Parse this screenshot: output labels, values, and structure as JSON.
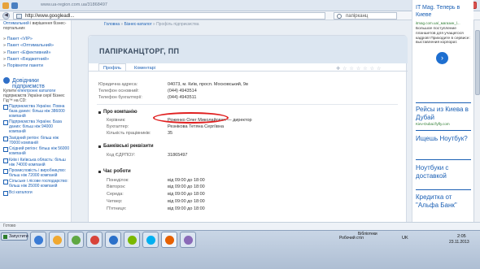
{
  "browser": {
    "ghost_url": "www.ua-region.com.ua/31868497",
    "url": "http://www.googleadl...",
    "search_text": "папірканц",
    "window_buttons": [
      "–",
      "□",
      "✕"
    ],
    "back_label": "◀"
  },
  "sidebar": {
    "intro_link": "Оптимальний",
    "intro_text": " і вирішення бізнес-портальних",
    "packages": [
      {
        "label": "Пакет «VIP»"
      },
      {
        "label": "Пакет «Оптимальний»"
      },
      {
        "label": "Пакет «Ефективний»"
      },
      {
        "label": "Пакет «Бюджетний»"
      },
      {
        "label": "Порівняти пакети"
      }
    ],
    "directory_title": "Довідники підприємств",
    "directory_intro_a": "Купити ",
    "directory_intro_link": "електронні каталоги",
    "directory_intro_b": " підприємств України серії Бізнес Гід™ на CD:",
    "directories": [
      "Підприємства України. Повна база даних: більш ніж 386000 компаній",
      "Підприємства України. База даних: більш ніж 94000 компаній",
      "Західний регіон: більш ніж 70000 компаній",
      "Східний регіон: більш ніж 56000 компаній",
      "Київ і Київська область: більш ніж 74000 компаній",
      "Промисловість і виробництво: більш ніж 72000 компаній",
      "Сільське і лісове господарство: більш ніж 25000 компаній",
      "Всі каталоги"
    ]
  },
  "main": {
    "crumb_home": "Головна",
    "crumb_catalog": "Бізнес-каталог",
    "crumb_current": "Профіль підприємства",
    "company_title": "ПАПІРКАНЦТОРГ, ПП",
    "tab_profile": "Профіль",
    "tab_comments": "Коментарі",
    "rating_icons": [
      "✚",
      "☆",
      "☆",
      "☆",
      "☆",
      "☆",
      "☆"
    ],
    "address_label": "Юридична адреса:",
    "address_value": "04073, м. Київ, просп. Московський, 9в",
    "phone_label": "Телефон основний:",
    "phone_value": "(044) 4943514",
    "accountant_phone_label": "Телефон бухгалтерії:",
    "accountant_phone_value": "(044) 4943511",
    "about_heading": "Про компанію",
    "head_label": "Керівник:",
    "head_value": "Роженко Олег Миколайович — директор",
    "bookkeeper_label": "Бухгалтер:",
    "bookkeeper_value": "Резнікова Тетяна Сергіївна",
    "staff_label": "Кількість працівників:",
    "staff_value": "35",
    "bank_heading": "Банківські реквізити",
    "edrpou_label": "Код ЄДРПОУ:",
    "edrpou_value": "31865497",
    "hours_heading": "Час роботи",
    "hours": [
      {
        "day": "Понеділок:",
        "time": "від 09:00 до 18:00"
      },
      {
        "day": "Вівторок:",
        "time": "від 09:00 до 18:00"
      },
      {
        "day": "Середа:",
        "time": "від 09:00 до 18:00"
      },
      {
        "day": "Четвер:",
        "time": "від 09:00 до 18:00"
      },
      {
        "day": "П'ятниця:",
        "time": "від 09:00 до 18:00"
      }
    ]
  },
  "ads": {
    "top": "IT Mag. Теперь в Киеве",
    "small": "itmag.com.ua/_магазин_l...",
    "text": "Большое поступление планшетов для учащегося кадров! Приходите в сервисе: выставления корпорат.",
    "arrow": "›",
    "ad2": "Рейсы из Киева в Дубай",
    "ad2_sub": "Kiev-Dubai.flyfly.com",
    "ad3": "Ищешь Ноутбук?",
    "ad4": "Ноутбуки с доставкой",
    "ad5": "Кредитка от \"Альфа Банк\""
  },
  "status": {
    "text": "Готово"
  },
  "taskbar": {
    "start": "Запустити",
    "work_table": "Робочий стіл",
    "library": "Бібліотеки",
    "lang": "UK",
    "time": "2:05",
    "date": "23.11.2013"
  },
  "colors": {
    "link": "#1a5fb4",
    "card_header": "#dce6f1",
    "highlight_ellipse": "#e02020",
    "taskbar": "#aebed3"
  }
}
